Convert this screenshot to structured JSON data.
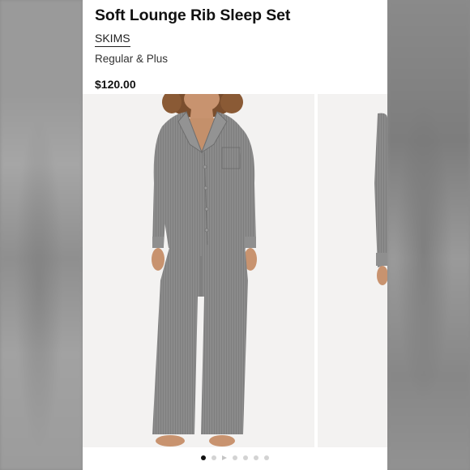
{
  "product": {
    "title": "Soft Lounge Rib Sleep Set",
    "brand": "SKIMS",
    "fit": "Regular & Plus",
    "price": "$120.00"
  },
  "gallery": {
    "active_index": 0,
    "dots": [
      "dot",
      "dot",
      "play",
      "dot",
      "dot",
      "dot",
      "dot"
    ],
    "garment_color": "#8a8a8a"
  },
  "colors": {
    "background_frame": "#8c8c8c",
    "panel": "#ffffff",
    "photo_backdrop": "#f3f2f1",
    "text": "#111111"
  }
}
